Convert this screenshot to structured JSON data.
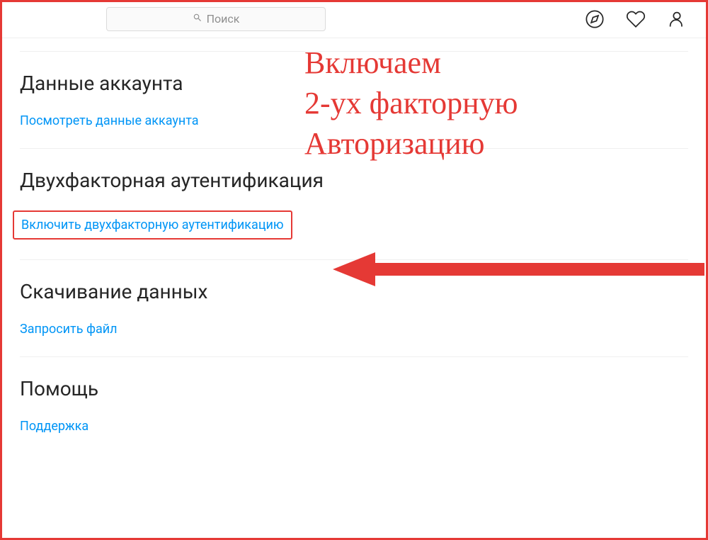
{
  "header": {
    "search_placeholder": "Поиск"
  },
  "sections": {
    "account_data": {
      "title": "Данные аккаунта",
      "link": "Посмотреть данные аккаунта"
    },
    "two_factor": {
      "title": "Двухфакторная аутентификация",
      "link": "Включить двухфакторную аутентификацию"
    },
    "download": {
      "title": "Скачивание данных",
      "link": "Запросить файл"
    },
    "help": {
      "title": "Помощь",
      "link": "Поддержка"
    }
  },
  "annotation": {
    "line1": "Включаем",
    "line2": "2-ух факторную",
    "line3": "Авторизацию"
  }
}
